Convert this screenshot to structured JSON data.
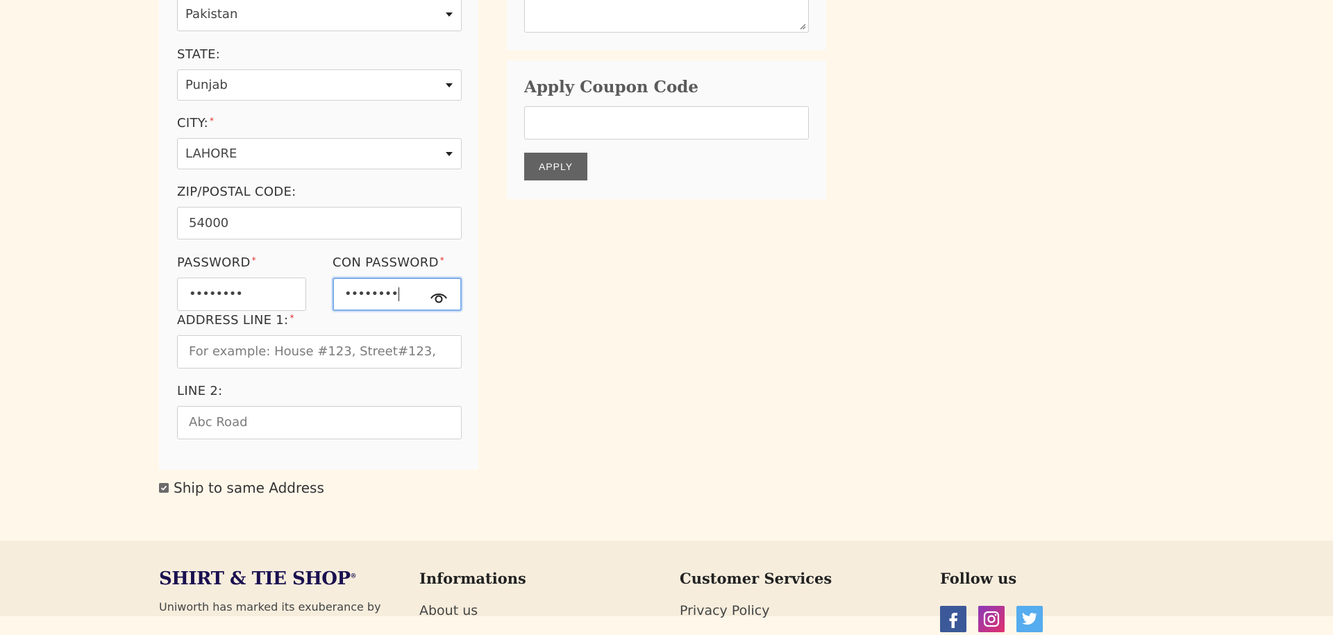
{
  "form": {
    "country_value": "Pakistan",
    "state_label": "STATE:",
    "state_value": "Punjab",
    "city_label": "CITY:",
    "city_value": "LAHORE",
    "zip_label": "ZIP/POSTAL CODE:",
    "zip_value": "54000",
    "password_label": "PASSWORD",
    "password_value": "••••••••",
    "con_password_label": "CON PASSWORD",
    "con_password_value": "••••••••",
    "address1_label": "ADDRESS LINE 1:",
    "address1_placeholder": "For example: House #123, Street#123,",
    "line2_label": "LINE 2:",
    "line2_placeholder": "Abc Road",
    "required_mark": "*"
  },
  "checkbox": {
    "label": "Ship to same Address",
    "checked": true
  },
  "coupon": {
    "title": "Apply Coupon Code",
    "input_value": "",
    "button_label": "APPLY"
  },
  "footer": {
    "brand": "SHIRT & TIE SHOP",
    "brand_mark": "®",
    "about_text": "Uniworth has marked its exuberance by",
    "informations_heading": "Informations",
    "informations_link": "About us",
    "customer_services_heading": "Customer Services",
    "customer_services_link": "Privacy Policy",
    "follow_heading": "Follow us",
    "social_icons": [
      "facebook-icon",
      "instagram-icon",
      "twitter-icon"
    ]
  },
  "colors": {
    "page_bg": "#fff8ea",
    "panel_bg": "#fafafa",
    "footer_bg": "#f6eddd",
    "button_bg": "#636363",
    "required": "#e0322d",
    "brand": "#1a1050",
    "focus_border": "#7faee8"
  }
}
